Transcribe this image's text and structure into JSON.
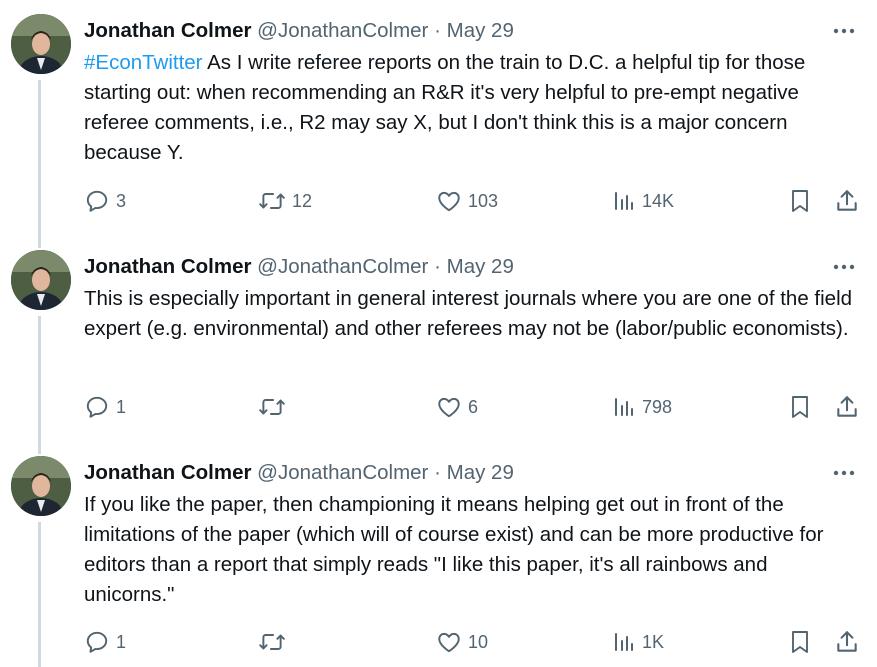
{
  "colors": {
    "text": "#0f1419",
    "secondary": "#536471",
    "link": "#1d9bf0",
    "thread_line": "#cfd9de"
  },
  "tweets": [
    {
      "name": "Jonathan Colmer",
      "handle": "@JonathanColmer",
      "separator": "·",
      "date": "May 29",
      "hashtag": "#EconTwitter",
      "text": "As I write referee reports on the train to D.C. a helpful tip for those starting out: when recommending an R&R it's very helpful to pre-empt negative referee comments, i.e., R2 may say X, but I don't think this is a major concern because Y.",
      "replies": "3",
      "retweets": "12",
      "likes": "103",
      "views": "14K"
    },
    {
      "name": "Jonathan Colmer",
      "handle": "@JonathanColmer",
      "separator": "·",
      "date": "May 29",
      "hashtag": "",
      "text": "This is especially important in general interest journals where you are one of the field expert (e.g. environmental) and other referees may not be (labor/public economists).",
      "replies": "1",
      "retweets": "",
      "likes": "6",
      "views": "798"
    },
    {
      "name": "Jonathan Colmer",
      "handle": "@JonathanColmer",
      "separator": "·",
      "date": "May 29",
      "hashtag": "",
      "text": "If you like the paper, then championing it means helping get out in front of the limitations of the paper (which will of course exist) and can be more productive for editors than a report that simply reads \"I like this paper, it's all rainbows and unicorns.\"",
      "replies": "1",
      "retweets": "",
      "likes": "10",
      "views": "1K"
    }
  ],
  "icons": {
    "more": "more-horizontal-icon",
    "reply": "reply-icon",
    "retweet": "retweet-icon",
    "like": "heart-icon",
    "views": "views-bar-chart-icon",
    "bookmark": "bookmark-icon",
    "share": "share-icon"
  }
}
